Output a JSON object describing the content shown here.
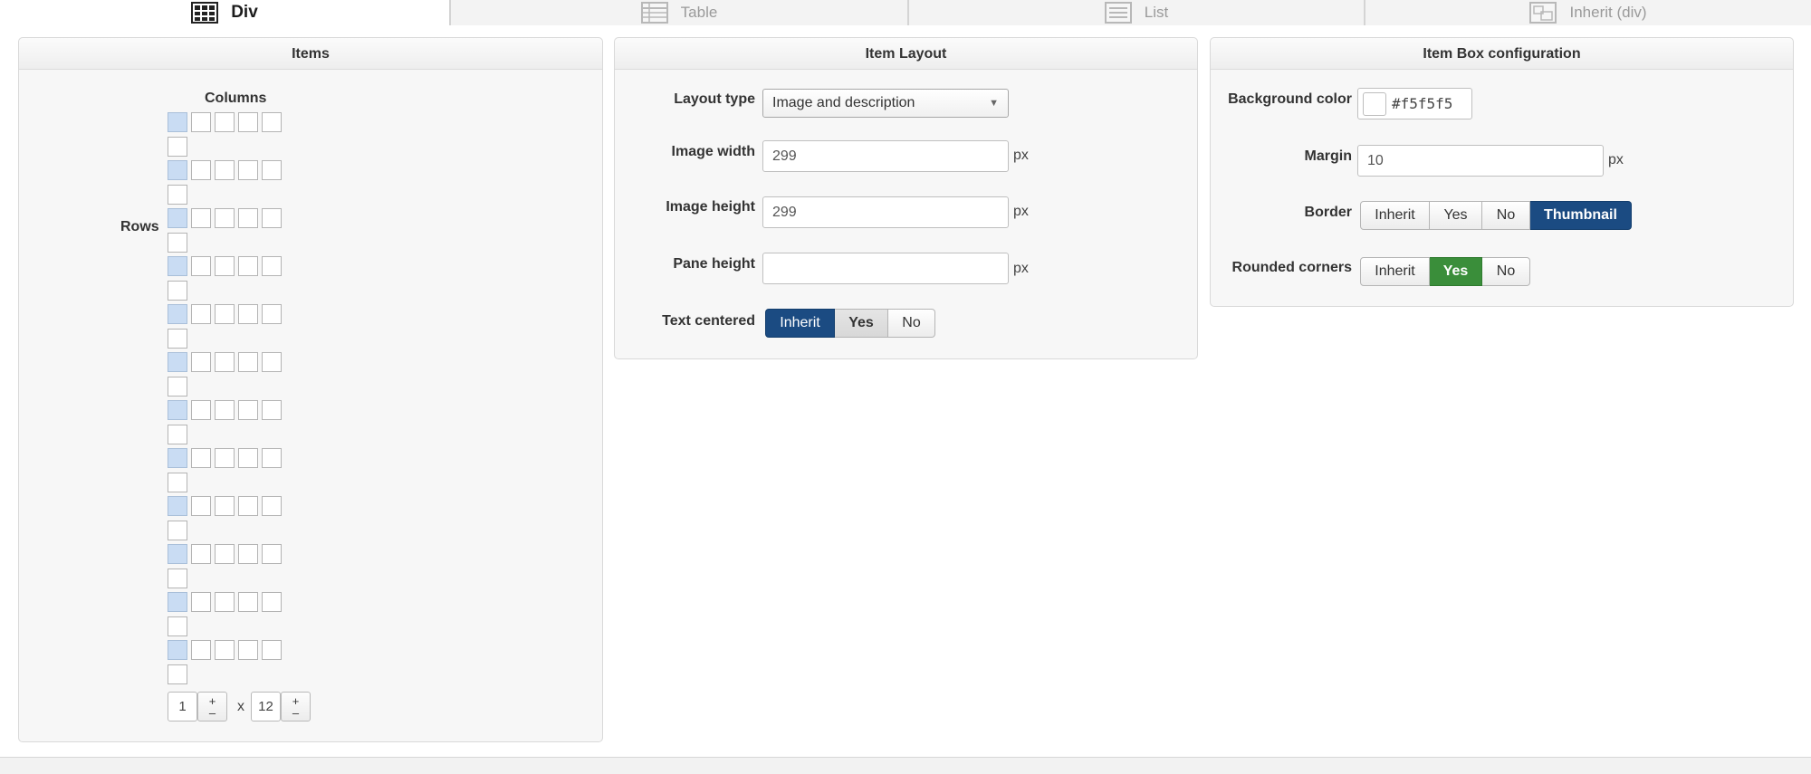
{
  "tabs": [
    {
      "label": "Div",
      "icon": "grid-icon",
      "active": true
    },
    {
      "label": "Table",
      "icon": "table-icon",
      "active": false
    },
    {
      "label": "List",
      "icon": "list-icon",
      "active": false
    },
    {
      "label": "Inherit (div)",
      "icon": "inherit-icon",
      "active": false
    }
  ],
  "items_panel": {
    "title": "Items",
    "columns_label": "Columns",
    "rows_label": "Rows",
    "columns_value": "1",
    "rows_value": "12",
    "times": "x",
    "plus": "+",
    "minus": "–"
  },
  "layout_panel": {
    "title": "Item Layout",
    "layout_type_label": "Layout type",
    "layout_type_value": "Image and description",
    "image_width_label": "Image width",
    "image_width_value": "299",
    "image_height_label": "Image height",
    "image_height_value": "299",
    "pane_height_label": "Pane height",
    "pane_height_value": "",
    "unit": "px",
    "text_centered_label": "Text centered",
    "text_centered_options": [
      "Inherit",
      "Yes",
      "No"
    ],
    "text_centered_selected": "Inherit"
  },
  "box_panel": {
    "title": "Item Box configuration",
    "bg_color_label": "Background color",
    "bg_color_value": "#f5f5f5",
    "margin_label": "Margin",
    "margin_value": "10",
    "unit": "px",
    "border_label": "Border",
    "border_options": [
      "Inherit",
      "Yes",
      "No",
      "Thumbnail"
    ],
    "border_selected": "Thumbnail",
    "rounded_label": "Rounded corners",
    "rounded_options": [
      "Inherit",
      "Yes",
      "No"
    ],
    "rounded_selected": "Yes"
  },
  "colors": {
    "selected_blue": "#1b4b82",
    "selected_green": "#3a8e3a",
    "grid_selected": "#c9dcf3"
  }
}
